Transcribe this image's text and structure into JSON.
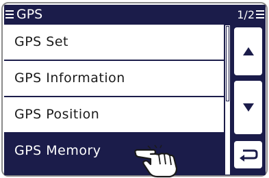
{
  "titlebar": {
    "title": "GPS",
    "page": "1/2"
  },
  "menu": {
    "items": [
      {
        "label": "GPS Set"
      },
      {
        "label": "GPS Information"
      },
      {
        "label": "GPS Position"
      },
      {
        "label": "GPS Memory"
      }
    ],
    "selected_index": 3
  },
  "colors": {
    "screen_bg": "#1b1c4a",
    "item_bg": "#ffffff",
    "text_dark": "#1a1a1a",
    "text_light": "#ffffff"
  },
  "icons": {
    "menu": "menu-icon",
    "list": "list-icon",
    "up": "up-arrow-icon",
    "down": "down-arrow-icon",
    "back": "back-arrow-icon",
    "pointer": "pointing-hand-icon"
  }
}
